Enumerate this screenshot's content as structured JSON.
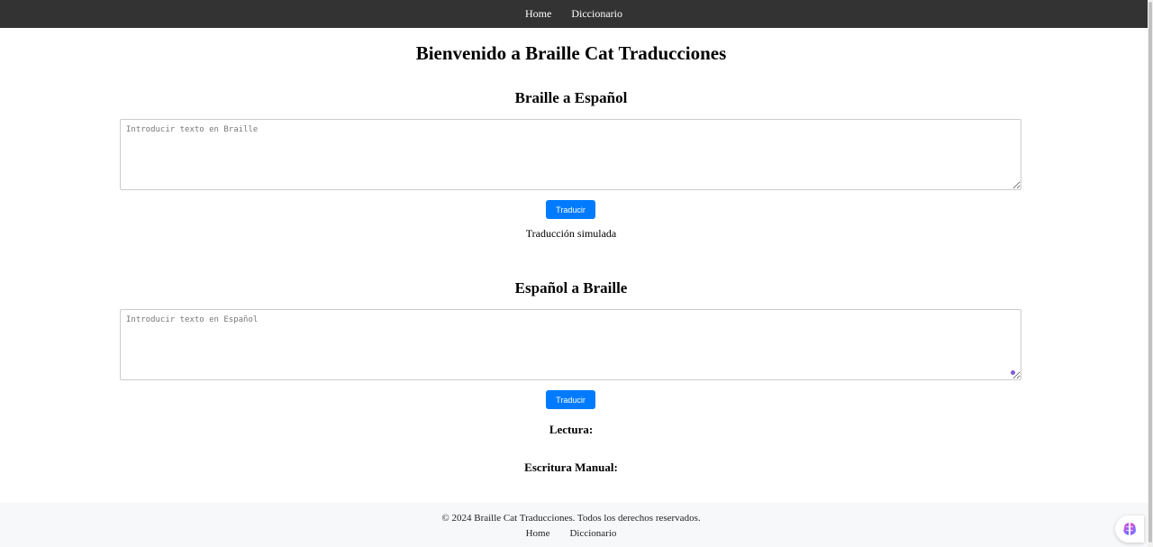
{
  "nav": {
    "items": [
      {
        "label": "Home"
      },
      {
        "label": "Diccionario"
      }
    ]
  },
  "page": {
    "title": "Bienvenido a Braille Cat Traducciones"
  },
  "braille_to_spanish": {
    "title": "Braille a Español",
    "placeholder": "Introducir texto en Braille",
    "button_label": "Traducir",
    "result": "Traducción simulada"
  },
  "spanish_to_braille": {
    "title": "Español a Braille",
    "placeholder": "Introducir texto en Español",
    "button_label": "Traducir",
    "reading_label": "Lectura:",
    "writing_label": "Escritura Manual:"
  },
  "footer": {
    "copyright": "© 2024 Braille Cat Traducciones. Todos los derechos reservados.",
    "items": [
      {
        "label": "Home"
      },
      {
        "label": "Diccionario"
      }
    ]
  },
  "icons": {
    "assistant": "assistant-brain-icon"
  },
  "colors": {
    "nav_bg": "#333333",
    "button": "#007bff",
    "footer_bg": "#f7f8fa"
  }
}
